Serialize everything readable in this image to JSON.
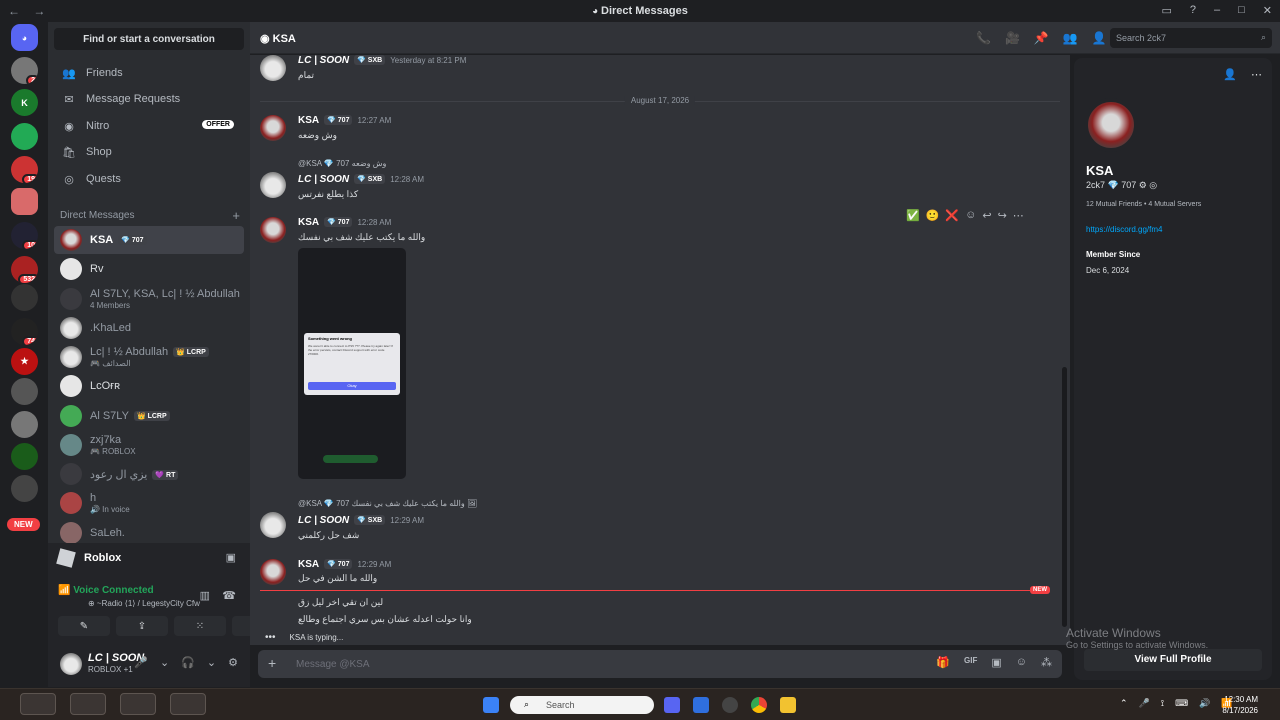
{
  "window": {
    "title": "Direct Messages",
    "back": "←",
    "forward": "→",
    "buttons": [
      "▭",
      "?",
      "–",
      "□",
      "✕"
    ]
  },
  "servers": [
    {
      "name": "home",
      "badge": ""
    },
    {
      "name": "server-2",
      "badge": "2"
    },
    {
      "name": "server-3",
      "badge": ""
    },
    {
      "name": "server-4",
      "badge": ""
    },
    {
      "name": "server-5",
      "badge": "19"
    },
    {
      "name": "server-6",
      "badge": ""
    },
    {
      "name": "server-7",
      "badge": "10"
    },
    {
      "name": "server-8",
      "badge": "532"
    },
    {
      "name": "server-9",
      "badge": ""
    },
    {
      "name": "server-10",
      "badge": "74"
    },
    {
      "name": "server-11",
      "badge": ""
    },
    {
      "name": "server-12",
      "badge": ""
    },
    {
      "name": "server-13",
      "badge": ""
    },
    {
      "name": "server-14",
      "badge": ""
    },
    {
      "name": "server-15",
      "badge": ""
    }
  ],
  "new_pill": "NEW",
  "sidebar": {
    "find": "Find or start a conversation",
    "nav": [
      {
        "label": "Friends",
        "icon": "👥"
      },
      {
        "label": "Message Requests",
        "icon": "✉"
      },
      {
        "label": "Nitro",
        "icon": "◉",
        "badge": "OFFER"
      },
      {
        "label": "Shop",
        "icon": "🛍"
      },
      {
        "label": "Quests",
        "icon": "◎"
      }
    ],
    "dm_header": "Direct Messages",
    "dm_add": "+",
    "dms": [
      {
        "name": "KSA",
        "tag": "💎 707",
        "sub": ""
      },
      {
        "name": "Rv",
        "tag": "",
        "sub": ""
      },
      {
        "name": "Al S7LY, KSA, Lc| ! ½ Abdullah",
        "tag": "",
        "sub": "4 Members"
      },
      {
        "name": ".KhaLed",
        "tag": "",
        "sub": ""
      },
      {
        "name": "Lc| ! ½ Abdullah",
        "tag": "👑 LCRP",
        "sub": "🎮 الصدائف"
      },
      {
        "name": "LcOғʀ",
        "tag": "",
        "sub": ""
      },
      {
        "name": "Al S7LY",
        "tag": "👑 LCRP",
        "sub": ""
      },
      {
        "name": "zxj7ka",
        "tag": "",
        "sub": "🎮 ROBLOX"
      },
      {
        "name": "يزي ال رعود",
        "tag": "💜 RT",
        "sub": ""
      },
      {
        "name": "h",
        "tag": "",
        "sub": "🔊 In voice"
      },
      {
        "name": "SaLeh.",
        "tag": "",
        "sub": ""
      }
    ]
  },
  "voice": {
    "game": "Roblox",
    "status": "Voice Connected",
    "channel": "⊕ ~Radio ⟨1⟩ / LegestyCity Cfw",
    "buttons": [
      "✎",
      "⇪",
      "⁙",
      "✦"
    ]
  },
  "user": {
    "name": "LC | SOON",
    "status": "ROBLOX +1",
    "icons": [
      "🎤",
      "⌄",
      "🎧",
      "⌄",
      "⚙"
    ]
  },
  "chat_header": {
    "name": "KSA",
    "icons": [
      "📞",
      "🎥",
      "📌",
      "👥",
      "👤"
    ],
    "search_placeholder": "Search 2ck7",
    "search_icon": "⌕"
  },
  "messages": [
    {
      "author": "LC | SOON",
      "tag": "💎 SXB",
      "time": "Yesterday at 8:21 PM",
      "text": "تمام"
    },
    {
      "author": "KSA",
      "tag": "💎 707",
      "time": "12:27 AM",
      "text": "وش وضعه"
    },
    {
      "reply": "@KSA 💎 707 وش وضعه",
      "author": "LC | SOON",
      "tag": "💎 SXB",
      "time": "12:28 AM",
      "text": "كذا يطلع نفرتس"
    },
    {
      "author": "KSA",
      "tag": "💎 707",
      "time": "12:28 AM",
      "text": "والله ما يكتب عليك شف بي نفسك"
    },
    {
      "reply": "@KSA 💎 707 والله ما يكتب عليك شف بي نفسك 🖼",
      "author": "LC | SOON",
      "tag": "💎 SXB",
      "time": "12:29 AM",
      "text": "شف حل ركلمني"
    },
    {
      "author": "KSA",
      "tag": "💎 707",
      "time": "12:29 AM",
      "text": "والله ما الشن في حل",
      "extra1": "لين ان تقي اخر ليل زق",
      "extra2": "وانا حولت اعدله عشان بس سري اجتماع وطالع"
    }
  ],
  "date_divider": "August 17, 2026",
  "new_label": "NEW",
  "attachment": {
    "dialog_title": "Something went wrong",
    "dialog_body": "We weren't able to connect to PS5 ???. Please try again later! If the error persists, contact Discord support with error code 270000.",
    "dialog_button": "Okay"
  },
  "hover_actions": [
    "✅",
    "🙂",
    "❌",
    "☺",
    "↩",
    "↪",
    "⋯"
  ],
  "typing": {
    "dots": "•••",
    "text": "KSA is typing..."
  },
  "composer": {
    "plus": "+",
    "placeholder": "Message @KSA",
    "icons": [
      "🎁",
      "GIF",
      "▣",
      "☺",
      "⁂"
    ]
  },
  "profile": {
    "name": "KSA",
    "username": "2ck7 💎 707 ⚙ ◎",
    "mutual": "12 Mutual Friends • 4 Mutual Servers",
    "link": "https://discord.gg/fm4",
    "member_since_label": "Member Since",
    "member_since": "Dec 6, 2024",
    "button": "View Full Profile",
    "icons": [
      "👤",
      "⋯"
    ]
  },
  "watermark": {
    "title": "Activate Windows",
    "sub": "Go to Settings to activate Windows."
  },
  "taskbar": {
    "search": "Search",
    "search_icon": "⌕",
    "time": "12:30 AM",
    "date": "8/17/2026",
    "tray": [
      "⌃",
      "🎤",
      "⟟",
      "⌨",
      "🔊",
      "📶"
    ]
  }
}
